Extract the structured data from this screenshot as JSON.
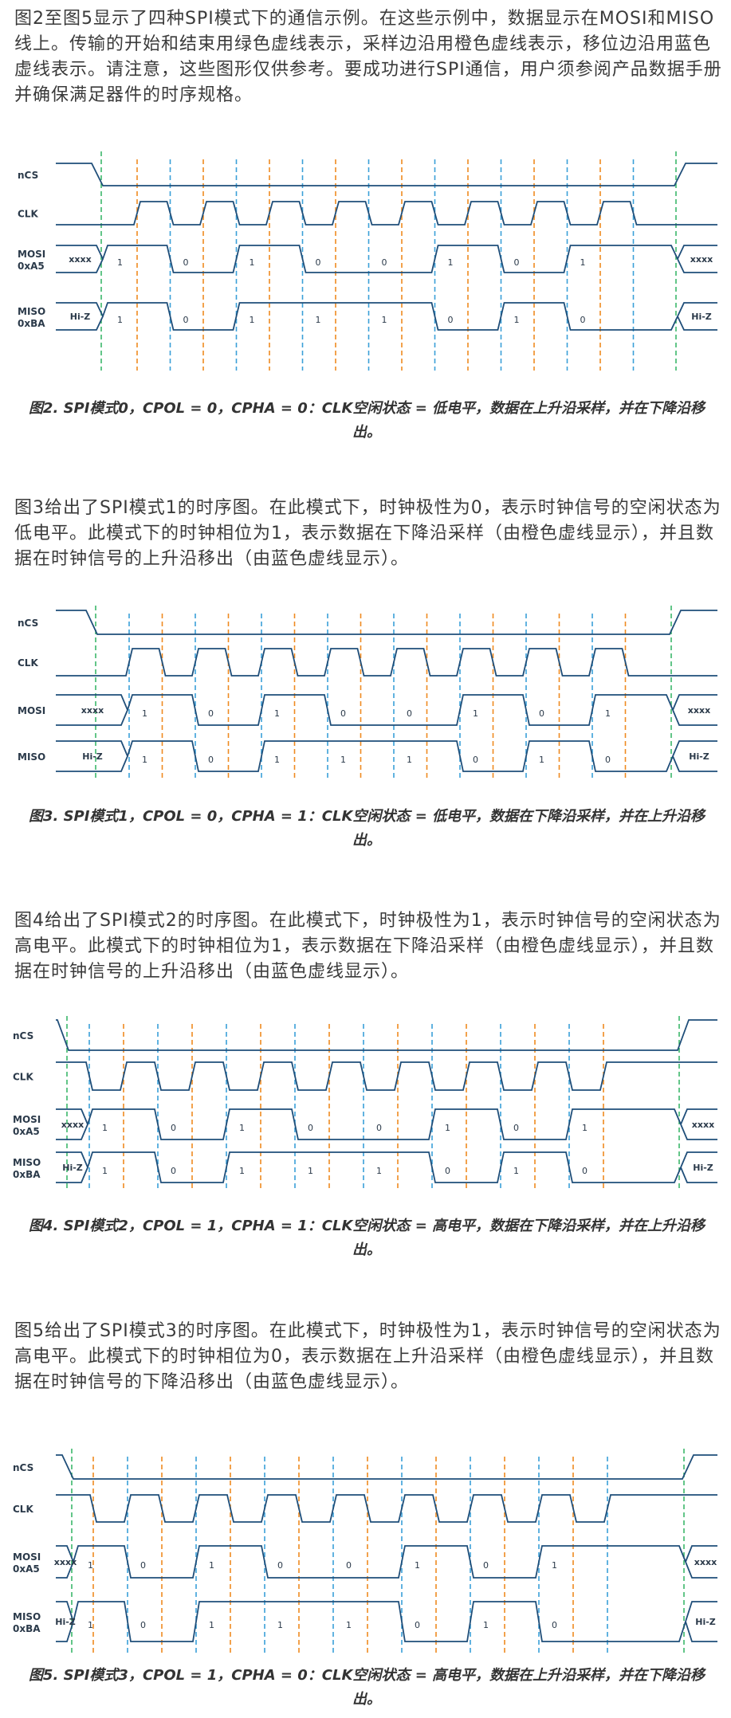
{
  "colors": {
    "wave": "#1f4e79",
    "sample_edge": "#ef8a20",
    "shift_edge": "#3aa0d8",
    "start_end": "#3cb76a",
    "text": "#3a3a3a"
  },
  "intro": "图2至图5显示了四种SPI模式下的通信示例。在这些示例中，数据显示在MOSI和MISO线上。传输的开始和结束用绿色虚线表示，采样边沿用橙色虚线表示，移位边沿用蓝色虚线表示。请注意，这些图形仅供参考。要成功进行SPI通信，用户须参阅产品数据手册并确保满足器件的时序规格。",
  "figures": [
    {
      "mode": 0,
      "cpol": 0,
      "cpha": 0,
      "labels": {
        "ncs": "nCS",
        "clk": "CLK",
        "mosi": "MOSI",
        "mosi_hex": "0xA5",
        "miso": "MISO",
        "miso_hex": "0xBA"
      },
      "mosi_bits": [
        "xxxx",
        "1",
        "0",
        "1",
        "0",
        "0",
        "1",
        "0",
        "1",
        "xxxx"
      ],
      "miso_bits": [
        "Hi-Z",
        "1",
        "0",
        "1",
        "1",
        "1",
        "0",
        "1",
        "0",
        "Hi-Z"
      ],
      "caption": "图2. SPI模式0，CPOL = 0，CPHA = 0：CLK空闲状态 = 低电平，数据在上升沿采样，并在下降沿移出。"
    },
    {
      "mode": 1,
      "cpol": 0,
      "cpha": 1,
      "description": "图3给出了SPI模式1的时序图。在此模式下，时钟极性为0，表示时钟信号的空闲状态为低电平。此模式下的时钟相位为1，表示数据在下降沿采样（由橙色虚线显示），并且数据在时钟信号的上升沿移出（由蓝色虚线显示）。",
      "labels": {
        "ncs": "nCS",
        "clk": "CLK",
        "mosi": "MOSI",
        "miso": "MISO"
      },
      "mosi_bits": [
        "xxxx",
        "1",
        "0",
        "1",
        "0",
        "0",
        "1",
        "0",
        "1",
        "xxxx"
      ],
      "miso_bits": [
        "Hi-Z",
        "1",
        "0",
        "1",
        "1",
        "1",
        "0",
        "1",
        "0",
        "Hi-Z"
      ],
      "caption": "图3. SPI模式1，CPOL = 0，CPHA = 1：CLK空闲状态 = 低电平，数据在下降沿采样，并在上升沿移出。"
    },
    {
      "mode": 2,
      "cpol": 1,
      "cpha": 1,
      "description": "图4给出了SPI模式2的时序图。在此模式下，时钟极性为1，表示时钟信号的空闲状态为高电平。此模式下的时钟相位为1，表示数据在下降沿采样（由橙色虚线显示），并且数据在时钟信号的上升沿移出（由蓝色虚线显示）。",
      "labels": {
        "ncs": "nCS",
        "clk": "CLK",
        "mosi": "MOSI",
        "mosi_hex": "0xA5",
        "miso": "MISO",
        "miso_hex": "0xBA"
      },
      "mosi_bits": [
        "xxxx",
        "1",
        "0",
        "1",
        "0",
        "0",
        "1",
        "0",
        "1",
        "xxxx"
      ],
      "miso_bits": [
        "Hi-Z",
        "1",
        "0",
        "1",
        "1",
        "1",
        "0",
        "1",
        "0",
        "Hi-Z"
      ],
      "caption": "图4. SPI模式2，CPOL = 1，CPHA = 1：CLK空闲状态 = 高电平，数据在下降沿采样，并在上升沿移出。"
    },
    {
      "mode": 3,
      "cpol": 1,
      "cpha": 0,
      "description": "图5给出了SPI模式3的时序图。在此模式下，时钟极性为1，表示时钟信号的空闲状态为高电平。此模式下的时钟相位为0，表示数据在上升沿采样（由橙色虚线显示），并且数据在时钟信号的下降沿移出（由蓝色虚线显示）。",
      "labels": {
        "ncs": "nCS",
        "clk": "CLK",
        "mosi": "MOSI",
        "mosi_hex": "0xA5",
        "miso": "MISO",
        "miso_hex": "0xBA"
      },
      "mosi_bits": [
        "xxxx",
        "1",
        "0",
        "1",
        "0",
        "0",
        "1",
        "0",
        "1",
        "xxxx"
      ],
      "miso_bits": [
        "Hi-Z",
        "1",
        "0",
        "1",
        "1",
        "1",
        "0",
        "1",
        "0",
        "Hi-Z"
      ],
      "caption": "图5. SPI模式3，CPOL = 1，CPHA = 0：CLK空闲状态 = 高电平，数据在上升沿采样，并在下降沿移出。"
    }
  ]
}
